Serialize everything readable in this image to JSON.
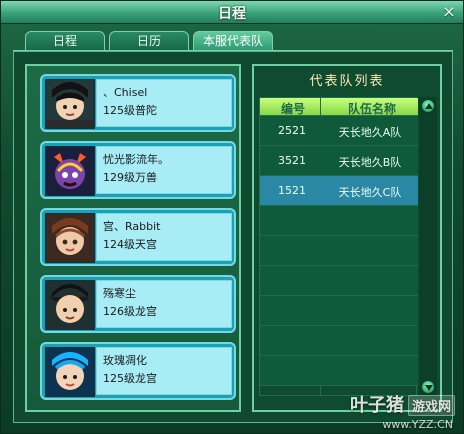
{
  "window": {
    "title": "日程",
    "close_glyph": "×"
  },
  "tabs": [
    {
      "label": "日程",
      "active": false
    },
    {
      "label": "日历",
      "active": false
    },
    {
      "label": "本服代表队",
      "active": true
    }
  ],
  "members": [
    {
      "name": "、Chisel",
      "level": "125级普陀",
      "avatar": "avatar-1"
    },
    {
      "name": "忧光影流年。",
      "level": "129级万兽",
      "avatar": "avatar-2"
    },
    {
      "name": "宫、Rabbit",
      "level": "124级天宫",
      "avatar": "avatar-3"
    },
    {
      "name": "殇寒尘",
      "level": "126级龙宫",
      "avatar": "avatar-4"
    },
    {
      "name": "玫瑰凋化",
      "level": "125级龙宫",
      "avatar": "avatar-5"
    }
  ],
  "team_list": {
    "title": "代表队列表",
    "headers": {
      "id": "编号",
      "team": "队伍名称"
    },
    "rows": [
      {
        "id": "2521",
        "team": "天长地久A队",
        "selected": false
      },
      {
        "id": "3521",
        "team": "天长地久B队",
        "selected": false
      },
      {
        "id": "1521",
        "team": "天长地久C队",
        "selected": true
      }
    ]
  },
  "watermark": {
    "brand": "叶子猪",
    "badge": "游戏网",
    "url": "www.YZZ.CN"
  }
}
